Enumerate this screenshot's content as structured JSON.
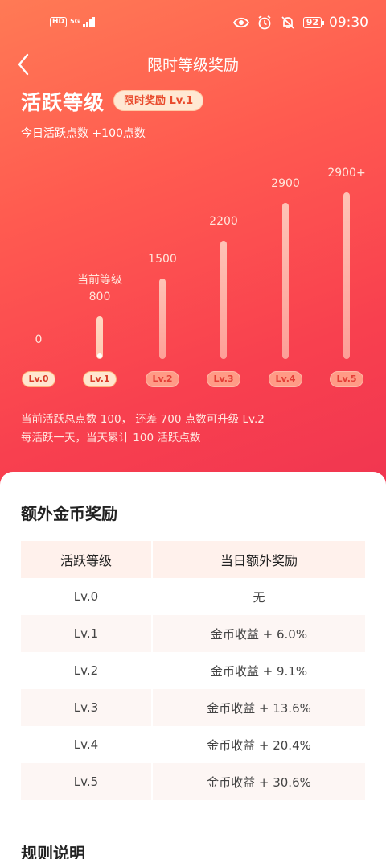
{
  "status_bar": {
    "hd": "HD",
    "network": "5G",
    "battery": "92",
    "time": "09:30"
  },
  "header": {
    "title": "限时等级奖励"
  },
  "activity": {
    "title": "活跃等级",
    "badge": "限时奖励 Lv.1",
    "today": "今日活跃点数 +100点数",
    "current_label": "当前等级"
  },
  "chart_data": {
    "type": "bar",
    "categories": [
      "Lv.0",
      "Lv.1",
      "Lv.2",
      "Lv.3",
      "Lv.4",
      "Lv.5"
    ],
    "value_labels": [
      "0",
      "800",
      "1500",
      "2200",
      "2900",
      "2900+"
    ],
    "values": [
      0,
      800,
      1500,
      2200,
      2900,
      3100
    ],
    "current_index": 1
  },
  "hints": {
    "line1": "当前活跃总点数 100， 还差 700 点数可升级 Lv.2",
    "line2": "每活跃一天，当天累计 100 活跃点数"
  },
  "rewards": {
    "title": "额外金币奖励",
    "headers": [
      "活跃等级",
      "当日额外奖励"
    ],
    "rows": [
      [
        "Lv.0",
        "无"
      ],
      [
        "Lv.1",
        "金币收益 + 6.0%"
      ],
      [
        "Lv.2",
        "金币收益 + 9.1%"
      ],
      [
        "Lv.3",
        "金币收益 + 13.6%"
      ],
      [
        "Lv.4",
        "金币收益 + 20.4%"
      ],
      [
        "Lv.5",
        "金币收益 + 30.6%"
      ]
    ]
  },
  "rules": {
    "title": "规则说明"
  }
}
